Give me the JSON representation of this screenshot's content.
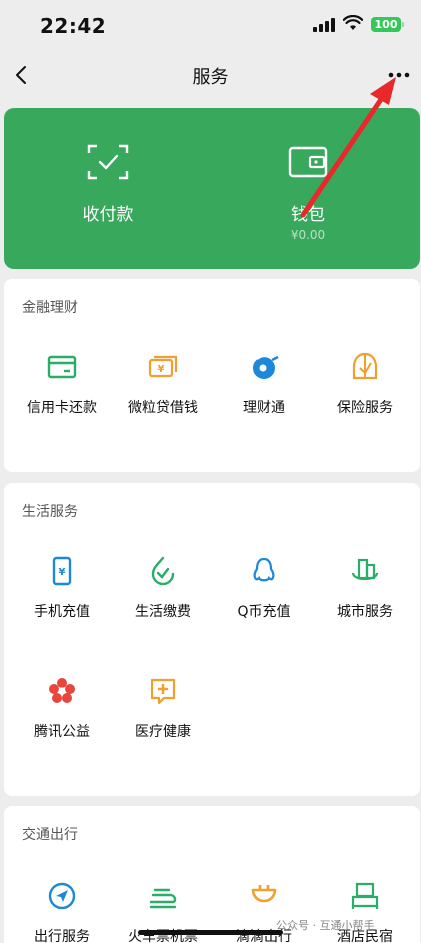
{
  "status_bar": {
    "time": "22:42",
    "battery": "100"
  },
  "nav": {
    "title": "服务"
  },
  "hero": {
    "pay_label": "收付款",
    "wallet_label": "钱包",
    "wallet_balance": "¥0.00"
  },
  "finance": {
    "title": "金融理财",
    "items": [
      {
        "label": "信用卡还款",
        "icon": "credit-card-icon"
      },
      {
        "label": "微粒贷借钱",
        "icon": "loan-icon"
      },
      {
        "label": "理财通",
        "icon": "wealth-icon"
      },
      {
        "label": "保险服务",
        "icon": "insurance-icon"
      }
    ]
  },
  "life": {
    "title": "生活服务",
    "items": [
      {
        "label": "手机充值",
        "icon": "phone-topup-icon"
      },
      {
        "label": "生活缴费",
        "icon": "bill-pay-icon"
      },
      {
        "label": "Q币充值",
        "icon": "qq-coin-icon"
      },
      {
        "label": "城市服务",
        "icon": "city-service-icon"
      },
      {
        "label": "腾讯公益",
        "icon": "charity-icon"
      },
      {
        "label": "医疗健康",
        "icon": "medical-icon"
      }
    ]
  },
  "transport": {
    "title": "交通出行",
    "items": [
      {
        "label": "出行服务",
        "icon": "travel-icon"
      },
      {
        "label": "火车票机票",
        "icon": "train-ticket-icon"
      },
      {
        "label": "滴滴出行",
        "icon": "didi-icon"
      },
      {
        "label": "酒店民宿",
        "icon": "hotel-icon"
      }
    ]
  },
  "watermark": "公众号 · 互通小帮手",
  "colors": {
    "brand_green": "#38a85d",
    "icon_green": "#2aae67",
    "icon_orange": "#f0a030",
    "icon_blue": "#1e88d8",
    "icon_red": "#e8453c",
    "arrow_red": "#e8282a"
  }
}
